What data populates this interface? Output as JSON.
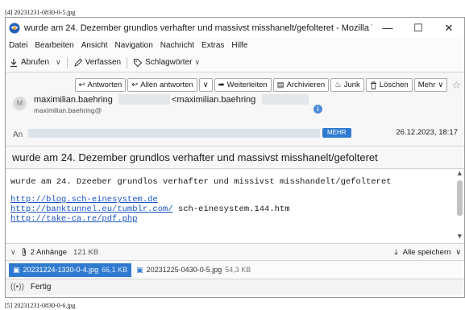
{
  "captions": {
    "top": "[4] 20231231-0830-0-5.jpg",
    "bottom": "[5] 20231231-0830-0-6.jpg"
  },
  "window": {
    "title": "wurde am 24. Dezember grundlos verhafter und massivst misshanelt/gefolteret - Mozilla Thund...",
    "minimize": "—",
    "maximize": "☐",
    "close": "✕"
  },
  "menu": [
    "Datei",
    "Bearbeiten",
    "Ansicht",
    "Navigation",
    "Nachricht",
    "Extras",
    "Hilfe"
  ],
  "toolbar": {
    "fetch": "Abrufen",
    "compose": "Verfassen",
    "tags": "Schlagwörter"
  },
  "actions": {
    "reply": "Antworten",
    "reply_all": "Allen antworten",
    "forward": "Weiterleiten",
    "archive": "Archivieren",
    "junk": "Junk",
    "delete": "Löschen",
    "more": "Mehr"
  },
  "header": {
    "avatar_letter": "M",
    "from_name": "maximilian.baehring",
    "from_addr": "<maximilian.baehring",
    "from_sub": "maximilian.baehring@",
    "to_label": "An",
    "more_badge": "MEHR",
    "date": "26.12.2023, 18:17",
    "subject": "wurde am 24. Dezember grundlos verhafter und massivst misshanelt/gefolteret"
  },
  "body": {
    "line1": "wurde am 24. Dzeeber grundlos verhafter und missivst misshandelt/gefolteret",
    "link1": "http://blog.sch-einesystem.de",
    "link2": "http://banktunnel.eu/tumblr.com/",
    "link2_suffix": " sch-einesystem.144.htm",
    "link3": "http://take-ca.re/pdf.php"
  },
  "attachments": {
    "summary": "2 Anhänge",
    "total_size": "121 KB",
    "save_all": "Alle speichern",
    "items": [
      {
        "name": "20231224-1330-0-4.jpg",
        "size": "66,1 KB"
      },
      {
        "name": "20231225-0430-0-5.jpg",
        "size": "54,3 KB"
      }
    ]
  },
  "status": {
    "text": "Fertig"
  },
  "colors": {
    "accent": "#2f7ad1",
    "link": "#1a55c6"
  }
}
